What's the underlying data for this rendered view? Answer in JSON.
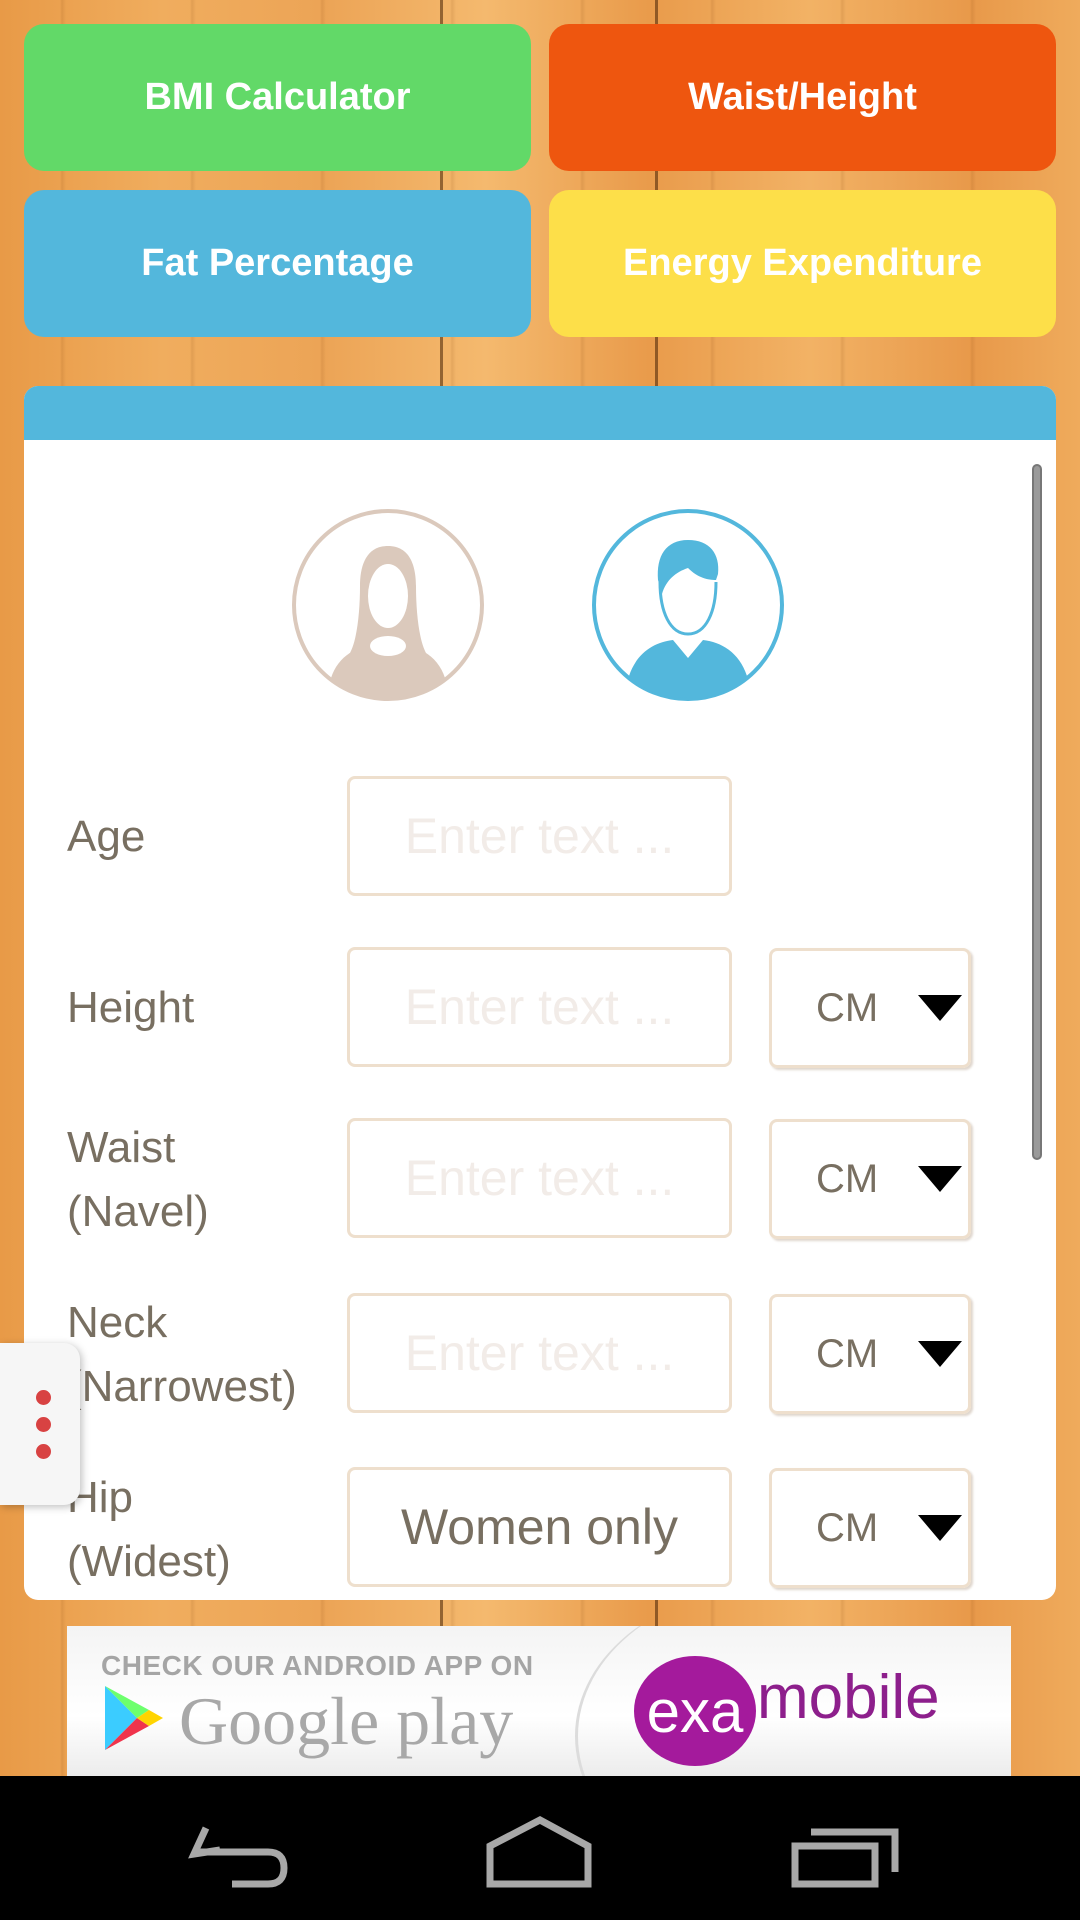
{
  "tiles": [
    {
      "label": "BMI Calculator",
      "color": "#62d968"
    },
    {
      "label": "Waist/Height",
      "color": "#ee560f"
    },
    {
      "label": "Fat Percentage",
      "color": "#53b7dc"
    },
    {
      "label": "Energy Expenditure",
      "color": "#fddf49"
    }
  ],
  "gender": {
    "options": [
      "female",
      "male"
    ],
    "selected": "male",
    "colors": {
      "female": "#dbc9bc",
      "male": "#53b7dc"
    }
  },
  "form": {
    "rows": [
      {
        "label_line1": "Age",
        "label_line2": "",
        "placeholder": "Enter text ...",
        "value": "",
        "unit": null
      },
      {
        "label_line1": "Height",
        "label_line2": "",
        "placeholder": "Enter text ...",
        "value": "",
        "unit": "CM"
      },
      {
        "label_line1": "Waist",
        "label_line2": "(Navel)",
        "placeholder": "Enter text ...",
        "value": "",
        "unit": "CM"
      },
      {
        "label_line1": "Neck",
        "label_line2": "(Narrowest)",
        "placeholder": "Enter text ...",
        "value": "",
        "unit": "CM"
      },
      {
        "label_line1": "Hip",
        "label_line2": "(Widest)",
        "placeholder": "",
        "value": "Women only",
        "unit": "CM"
      }
    ]
  },
  "ad": {
    "top_text": "CHECK OUR ANDROID APP ON",
    "store": "Google play",
    "brand_a": "exa",
    "brand_b": "mobile"
  },
  "nav": {
    "back": "back-icon",
    "home": "home-icon",
    "recents": "recents-icon"
  }
}
